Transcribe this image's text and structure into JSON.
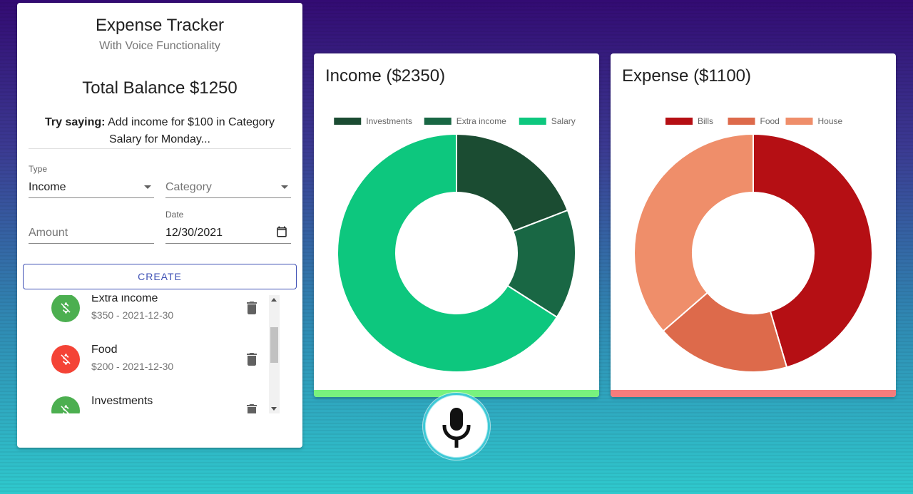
{
  "app": {
    "title": "Expense Tracker",
    "subtitle": "With Voice Functionality"
  },
  "balance": {
    "text": "Total Balance $1250"
  },
  "hint": {
    "prefix": "Try saying:",
    "text": " Add income for $100 in Category Salary for Monday..."
  },
  "form": {
    "type_label": "Type",
    "type_value": "Income",
    "category_placeholder": "Category",
    "amount_placeholder": "Amount",
    "date_label": "Date",
    "date_value": "12/30/2021",
    "create_label": "CREATE"
  },
  "transactions": [
    {
      "title": "Extra income",
      "subtitle": "$350 - 2021-12-30",
      "kind": "income",
      "color": "#4caf50"
    },
    {
      "title": "Food",
      "subtitle": "$200 - 2021-12-30",
      "kind": "expense",
      "color": "#f44336"
    },
    {
      "title": "Investments",
      "subtitle": "",
      "kind": "income",
      "color": "#4caf50"
    }
  ],
  "icons": {
    "transaction": "money-off-icon",
    "delete": "delete-icon",
    "mic": "mic-icon",
    "date": "calendar-icon",
    "dropdown": "caret-down-icon"
  },
  "income_card": {
    "title": "Income ($2350)",
    "bar_color": "#78f27e"
  },
  "expense_card": {
    "title": "Expense ($1100)",
    "bar_color": "#f47c7c"
  },
  "chart_data": [
    {
      "type": "doughnut",
      "title": "Income ($2350)",
      "categories": [
        "Investments",
        "Extra income",
        "Salary"
      ],
      "values": [
        450,
        350,
        1550
      ],
      "colors": [
        "#1b4c32",
        "#196744",
        "#0dc77e"
      ],
      "legend": "top"
    },
    {
      "type": "doughnut",
      "title": "Expense ($1100)",
      "categories": [
        "Bills",
        "Food",
        "House"
      ],
      "values": [
        500,
        200,
        400
      ],
      "colors": [
        "#b50f14",
        "#dd6a4b",
        "#ef8e6a"
      ],
      "legend": "top"
    }
  ]
}
